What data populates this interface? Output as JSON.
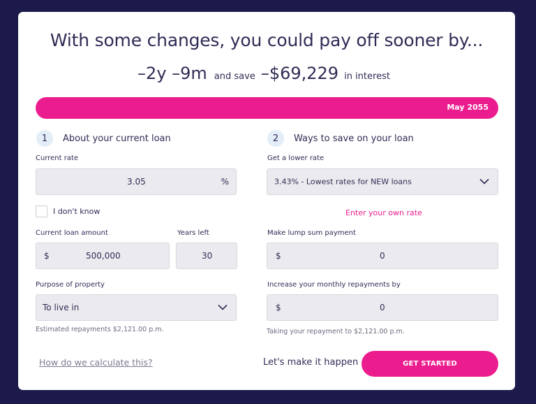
{
  "header": {
    "headline": "With some changes, you could pay off sooner by...",
    "time_saved": "–2y –9m",
    "and_save": "and save",
    "amount_saved": "–$69,229",
    "in_interest": "in interest"
  },
  "progress": {
    "date_label": "May 2055",
    "color": "#eb1d8e"
  },
  "current_loan": {
    "step_number": "1",
    "title": "About your current loan",
    "rate_label": "Current rate",
    "rate_value": "3.05",
    "rate_unit": "%",
    "dont_know_label": "I don't know",
    "dont_know_checked": false,
    "amount_label": "Current loan amount",
    "amount_currency": "$",
    "amount_value": "500,000",
    "years_label": "Years left",
    "years_value": "30",
    "purpose_label": "Purpose of property",
    "purpose_value": "To live in",
    "estimate_text": "Estimated repayments $2,121.00 p.m."
  },
  "ways_to_save": {
    "step_number": "2",
    "title": "Ways to save on your loan",
    "lower_rate_label": "Get a lower rate",
    "lower_rate_value": "3.43% - Lowest rates for NEW loans",
    "own_rate_link": "Enter your own rate",
    "lump_label": "Make lump sum payment",
    "lump_currency": "$",
    "lump_value": "0",
    "increase_label": "Increase your monthly repayments by",
    "increase_currency": "$",
    "increase_value": "0",
    "taking_text": "Taking your repayment to $2,121.00 p.m."
  },
  "footer": {
    "calc_link": "How do we calculate this?",
    "cta_text": "Let's make it happen",
    "cta_button": "GET STARTED"
  },
  "colors": {
    "accent": "#eb1d8e",
    "background": "#1b1a4a",
    "text": "#2f2c55"
  },
  "icons": [
    "chevron-down-icon"
  ]
}
